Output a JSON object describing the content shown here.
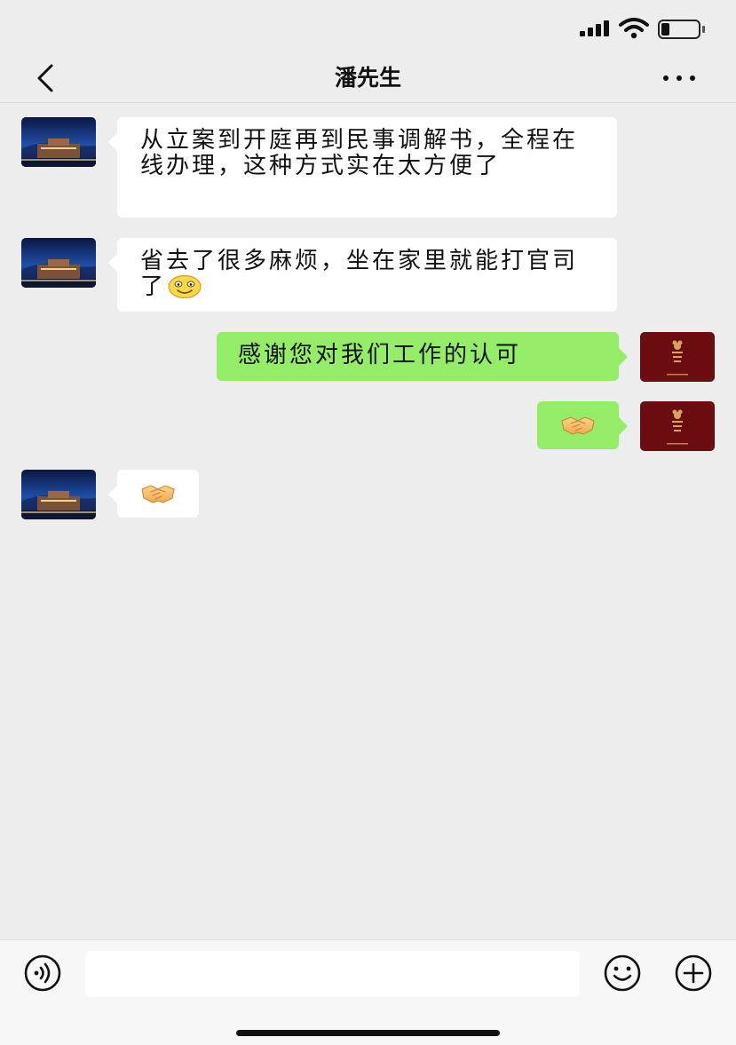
{
  "status_bar": {
    "signal_icon": "cellular-signal-icon",
    "wifi_icon": "wifi-icon",
    "battery_icon": "battery-icon",
    "battery_level": 0.15
  },
  "nav": {
    "back_icon": "chevron-left-icon",
    "title": "潘先生",
    "more_icon": "more-dots-icon"
  },
  "messages": [
    {
      "side": "left",
      "type": "text",
      "text": "从立案到开庭再到民事调解书，全程在线办理，这种方式实在太方便了"
    },
    {
      "side": "left",
      "type": "text",
      "text": "省去了很多麻烦，坐在家里就能打官司了",
      "emoji": "smile-emoji"
    },
    {
      "side": "right",
      "type": "text",
      "text": "感谢您对我们工作的认可"
    },
    {
      "side": "right",
      "type": "emoji",
      "emoji": "handshake-emoji"
    },
    {
      "side": "left",
      "type": "emoji",
      "emoji": "handshake-emoji"
    }
  ],
  "colors": {
    "background": "#ededed",
    "bubble_sent": "#95ec69",
    "bubble_received": "#ffffff",
    "avatar_self": "#6b0d10"
  },
  "input_bar": {
    "voice_icon": "voice-icon",
    "text_value": "",
    "emoji_icon": "emoji-face-icon",
    "plus_icon": "plus-circle-icon"
  }
}
